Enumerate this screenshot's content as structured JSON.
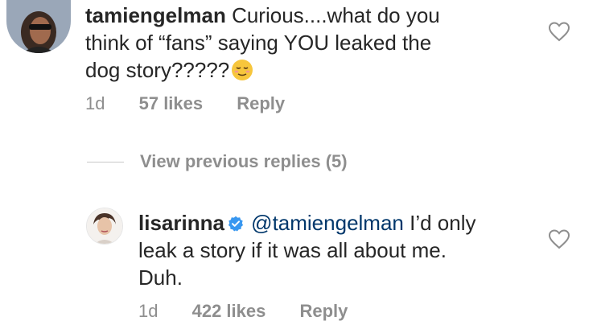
{
  "comment": {
    "username": "tamiengelman",
    "text_line1": "Curious....what do you",
    "text_line2": "think of “fans” saying YOU leaked the",
    "text_line3": "dog story?????",
    "emoji": "relieved-face-emoji",
    "time": "1d",
    "likes": "57 likes",
    "reply_label": "Reply"
  },
  "view_previous": {
    "label": "View previous replies (5)"
  },
  "reply": {
    "username": "lisarinna",
    "verified_icon": "verified-badge-icon",
    "mention": "@tamiengelman",
    "text_line1_rest": " I’d only",
    "text_line2": "leak a story if it was all about me.",
    "text_line3": "Duh.",
    "time": "1d",
    "likes": "422 likes",
    "reply_label": "Reply"
  },
  "colors": {
    "text": "#262626",
    "secondary": "#8e8e8e",
    "verified": "#3897f0"
  }
}
